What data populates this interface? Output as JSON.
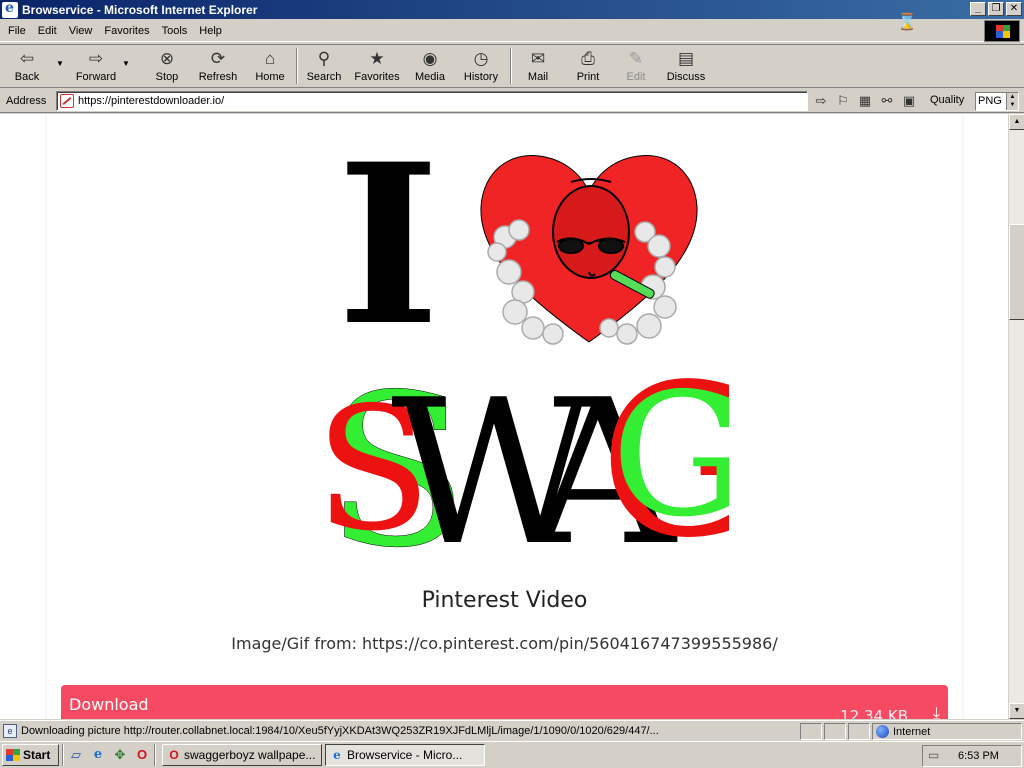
{
  "window": {
    "title": "Browservice - Microsoft Internet Explorer"
  },
  "menu": [
    "File",
    "Edit",
    "View",
    "Favorites",
    "Tools",
    "Help"
  ],
  "toolbar": {
    "back": "Back",
    "forward": "Forward",
    "stop": "Stop",
    "refresh": "Refresh",
    "home": "Home",
    "search": "Search",
    "favorites": "Favorites",
    "media": "Media",
    "history": "History",
    "mail": "Mail",
    "print": "Print",
    "edit": "Edit",
    "discuss": "Discuss"
  },
  "address": {
    "label": "Address",
    "url": "https://pinterestdownloader.io/",
    "quality_label": "Quality",
    "quality_value": "PNG"
  },
  "page": {
    "title": "Pinterest Video",
    "source_label": "Image/Gif from: https://co.pinterest.com/pin/560416747399555986/",
    "image_text": {
      "top_letter": "I",
      "word": [
        "S",
        "W",
        "A",
        "G"
      ]
    },
    "download": {
      "label": "Download",
      "size": "12.34 KB"
    }
  },
  "status": {
    "text": "Downloading picture http://router.collabnet.local:1984/10/Xeu5fYyjXKDAt3WQ253ZR19XJFdLMljL/image/1/1090/0/1020/629/447/...",
    "zone": "Internet"
  },
  "taskbar": {
    "start": "Start",
    "tasks": [
      {
        "label": "swaggerboyz wallpape..."
      },
      {
        "label": "Browservice - Micro..."
      }
    ],
    "clock": "6:53 PM"
  },
  "colors": {
    "download_bar": "#f64a63",
    "title_bar_start": "#0a246a",
    "title_bar_end": "#3a6ea5",
    "heart": "#f02424",
    "swag_green": "#33ee33",
    "swag_red": "#ee1111"
  }
}
